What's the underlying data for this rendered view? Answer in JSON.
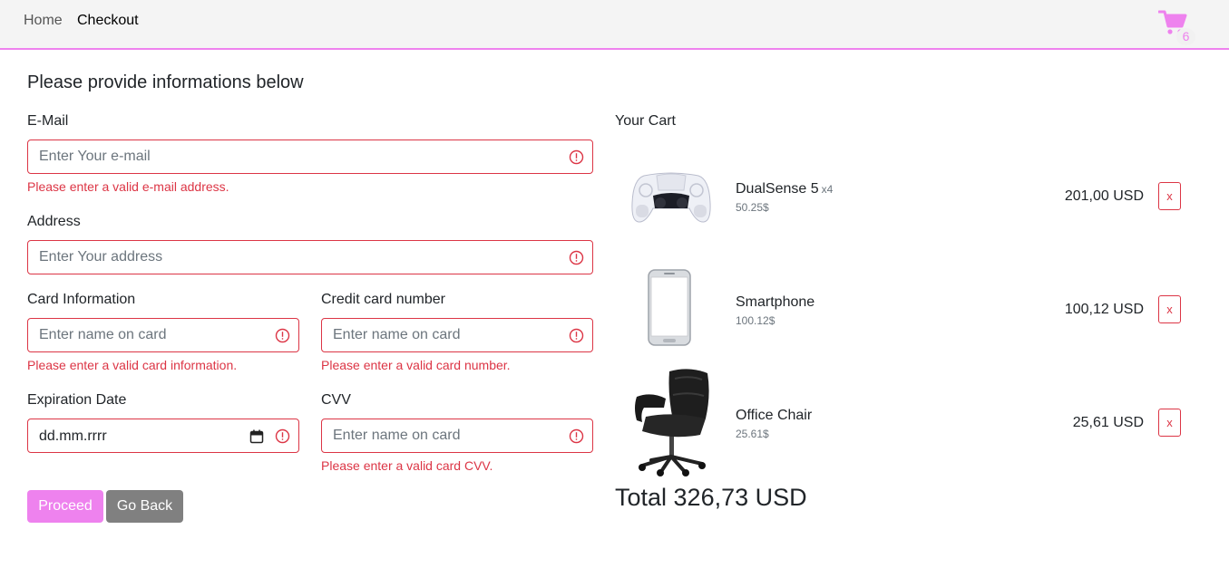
{
  "nav": {
    "home": "Home",
    "checkout": "Checkout",
    "cart_count": "6",
    "accent_color": "#ee82ee"
  },
  "form": {
    "title": "Please provide informations below",
    "email": {
      "label": "E-Mail",
      "placeholder": "Enter Your e-mail",
      "error": "Please enter a valid e-mail address."
    },
    "address": {
      "label": "Address",
      "placeholder": "Enter Your address"
    },
    "card_info": {
      "label": "Card Information",
      "placeholder": "Enter name on card",
      "error": "Please enter a valid card information."
    },
    "card_number": {
      "label": "Credit card number",
      "placeholder": "Enter name on card",
      "error": "Please enter a valid card number."
    },
    "expiration": {
      "label": "Expiration Date",
      "placeholder": "dd.mm.rrrr"
    },
    "cvv": {
      "label": "CVV",
      "placeholder": "Enter name on card",
      "error": "Please enter a valid card CVV."
    },
    "error_color": "#dc3545",
    "icons": [
      "exclamation-circle-icon",
      "calendar-icon",
      "shopping-cart-icon"
    ],
    "proceed_label": "Proceed",
    "back_label": "Go Back"
  },
  "cart": {
    "title": "Your Cart",
    "items": [
      {
        "name": "DualSense 5",
        "qty": "x4",
        "unit_price": "50.25$",
        "total": "201,00 USD",
        "remove": "x"
      },
      {
        "name": "Smartphone",
        "qty": "",
        "unit_price": "100.12$",
        "total": "100,12 USD",
        "remove": "x"
      },
      {
        "name": "Office Chair",
        "qty": "",
        "unit_price": "25.61$",
        "total": "25,61 USD",
        "remove": "x"
      }
    ],
    "total": "Total 326,73 USD"
  }
}
